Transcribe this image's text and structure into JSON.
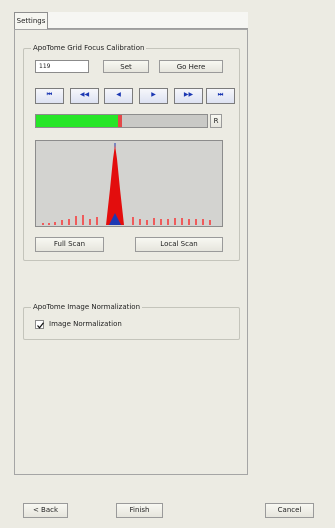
{
  "tabs": [
    {
      "label": "Settings"
    }
  ],
  "calibration": {
    "title": "ApoTome Grid Focus Calibration",
    "value": "119",
    "set_label": "Set",
    "go_here_label": "Go Here",
    "nav_buttons": [
      {
        "label": "⏮",
        "name": "first-button-icon"
      },
      {
        "label": "◀◀",
        "name": "rewind-button-icon"
      },
      {
        "label": "◀",
        "name": "step-back-button-icon"
      },
      {
        "label": "▶",
        "name": "step-forward-button-icon"
      },
      {
        "label": "▶▶",
        "name": "fast-forward-button-icon"
      },
      {
        "label": "⏭",
        "name": "last-button-icon"
      }
    ],
    "r_label": "R",
    "progress": 0.49,
    "full_scan_label": "Full Scan",
    "local_scan_label": "Local Scan"
  },
  "normalization": {
    "title": "ApoTome Image Normalization",
    "checkbox_label": "Image Normalization",
    "checked": true
  },
  "footer": {
    "back_label": "< Back",
    "finish_label": "Finish",
    "cancel_label": "Cancel"
  },
  "colors": {
    "accent": "#1c38b3",
    "progress": "#27e628",
    "peak": "#e30d0d"
  }
}
